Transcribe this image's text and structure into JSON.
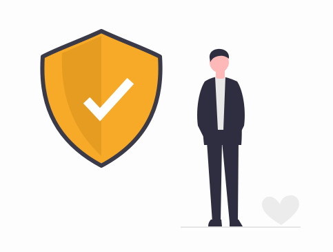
{
  "colors": {
    "shield_fill": "#f7a928",
    "shield_shade": "#d9911a",
    "shield_outline": "#3a3a48",
    "checkmark": "#ffffff",
    "suit": "#2f2e41",
    "shirt": "#e8e8e8",
    "skin": "#ffb8b8",
    "hair": "#2f2e41",
    "heart": "#ececec",
    "ground": "#e6e6e6",
    "shoes": "#2f2e41"
  },
  "icons": {
    "shield": "shield-check-icon",
    "heart": "heart-icon"
  }
}
